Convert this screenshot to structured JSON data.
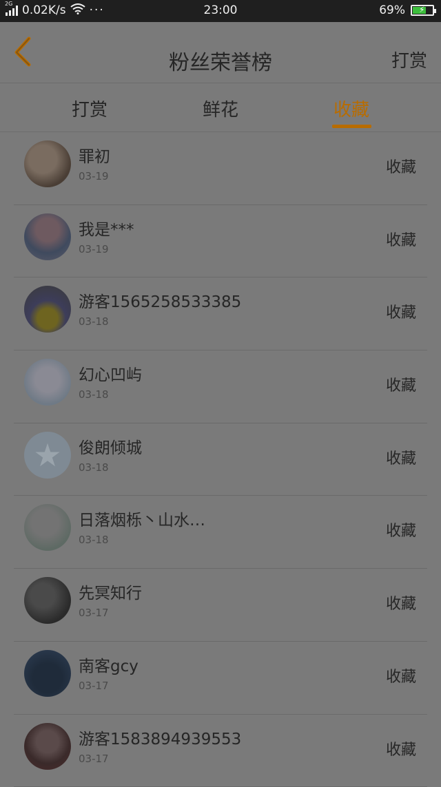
{
  "status_bar": {
    "network_type": "2G",
    "speed": "0.02K/s",
    "more": "···",
    "time": "23:00",
    "battery": "69%",
    "battery_level": 0.69
  },
  "header": {
    "title": "粉丝荣誉榜",
    "action_label": "打赏",
    "back_icon": "chevron-left-icon"
  },
  "tabs": [
    {
      "label": "打赏"
    },
    {
      "label": "鲜花"
    },
    {
      "label": "收藏"
    }
  ],
  "active_tab": "收藏",
  "colors": {
    "accent": "#b86c00",
    "background": "#7a7a7a",
    "statusbar": "#1f1f1f"
  },
  "items": [
    {
      "name": "罪初",
      "date": "03-19",
      "action": "收藏"
    },
    {
      "name": "我是***",
      "date": "03-19",
      "action": "收藏"
    },
    {
      "name": "游客1565258533385",
      "date": "03-18",
      "action": "收藏"
    },
    {
      "name": "幻心凹屿",
      "date": "03-18",
      "action": "收藏"
    },
    {
      "name": "俊朗倾城",
      "date": "03-18",
      "action": "收藏"
    },
    {
      "name": "日落烟栎丶山水…",
      "date": "03-18",
      "action": "收藏"
    },
    {
      "name": "先冥知行",
      "date": "03-17",
      "action": "收藏"
    },
    {
      "name": "南客gcy",
      "date": "03-17",
      "action": "收藏"
    },
    {
      "name": "游客1583894939553",
      "date": "03-17",
      "action": "收藏"
    }
  ]
}
